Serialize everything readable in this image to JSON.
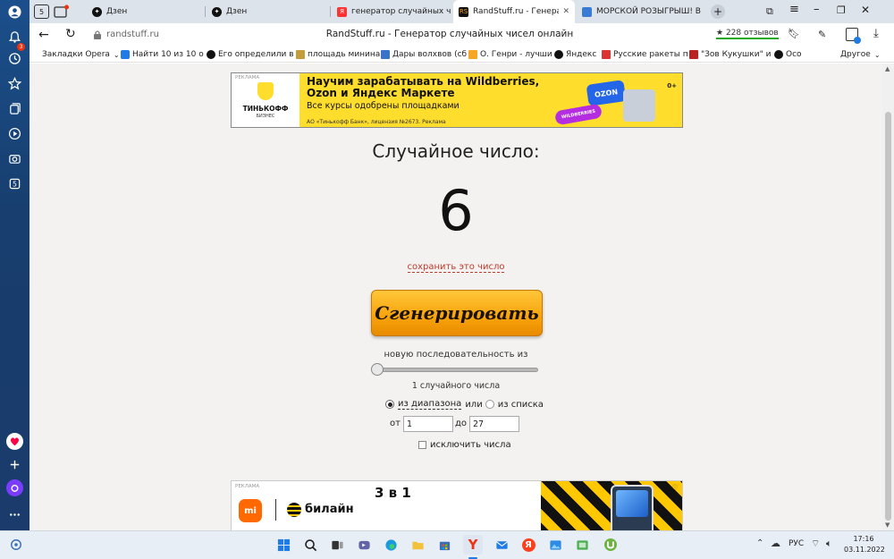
{
  "tabs": [
    {
      "label": "Дзен"
    },
    {
      "label": "Дзен"
    },
    {
      "label": "генератор случайных чис"
    },
    {
      "label": "RandStuff.ru - Генерато"
    },
    {
      "label": "МОРСКОЙ РОЗЫГРЫШ! В"
    }
  ],
  "address": {
    "domain": "randstuff.ru",
    "title": "RandStuff.ru - Генератор случайных чисел онлайн",
    "reviews": "228 отзывов"
  },
  "bookmarks": [
    {
      "label": "Закладки Opera"
    },
    {
      "label": "Найти 10 из 10 о"
    },
    {
      "label": "Его определили в"
    },
    {
      "label": "площадь минина"
    },
    {
      "label": "Дары волхвов (сб"
    },
    {
      "label": "О. Генри - лучши"
    },
    {
      "label": "Яндекс"
    },
    {
      "label": "Русские ракеты п"
    },
    {
      "label": "\"Зов Кукушки\" и"
    },
    {
      "label": "Осо"
    },
    {
      "label": "Другое"
    }
  ],
  "ad_top": {
    "tag": "РЕКЛАМА",
    "brand": "ТИНЬКОФФ",
    "brand_sub": "БИЗНЕС",
    "headline": "Научим зарабатывать на Wildberries, Ozon и Яндекс Маркете",
    "subline": "Все курсы одобрены площадками",
    "legal": "АО «Тинькофф Банк», лицензия №2673. Реклама",
    "ozon": "OZON",
    "wb": "WILDBERRIES",
    "age": "0+"
  },
  "generator": {
    "heading": "Случайное число:",
    "result": "6",
    "save_link": "сохранить это число",
    "button": "Сгенерировать",
    "sequence_label": "новую последовательность из",
    "count_label": "1 случайного числа",
    "range_option": "из диапазона",
    "or_text": "или",
    "list_option": "из списка",
    "from_label": "от",
    "from_value": "1",
    "to_label": "до",
    "to_value": "27",
    "exclude_label": "исключить числа"
  },
  "ad_bottom": {
    "tag": "РЕКЛАМА",
    "xiaomi": "mi",
    "beeline": "билайн",
    "headline": "3 в 1"
  },
  "taskbar": {
    "lang": "РУС",
    "time": "17:16",
    "date": "03.11.2022"
  },
  "colors": {
    "button_orange": "#f7a30a",
    "ad_yellow": "#ffdd2d",
    "link_red": "#c0392b"
  }
}
